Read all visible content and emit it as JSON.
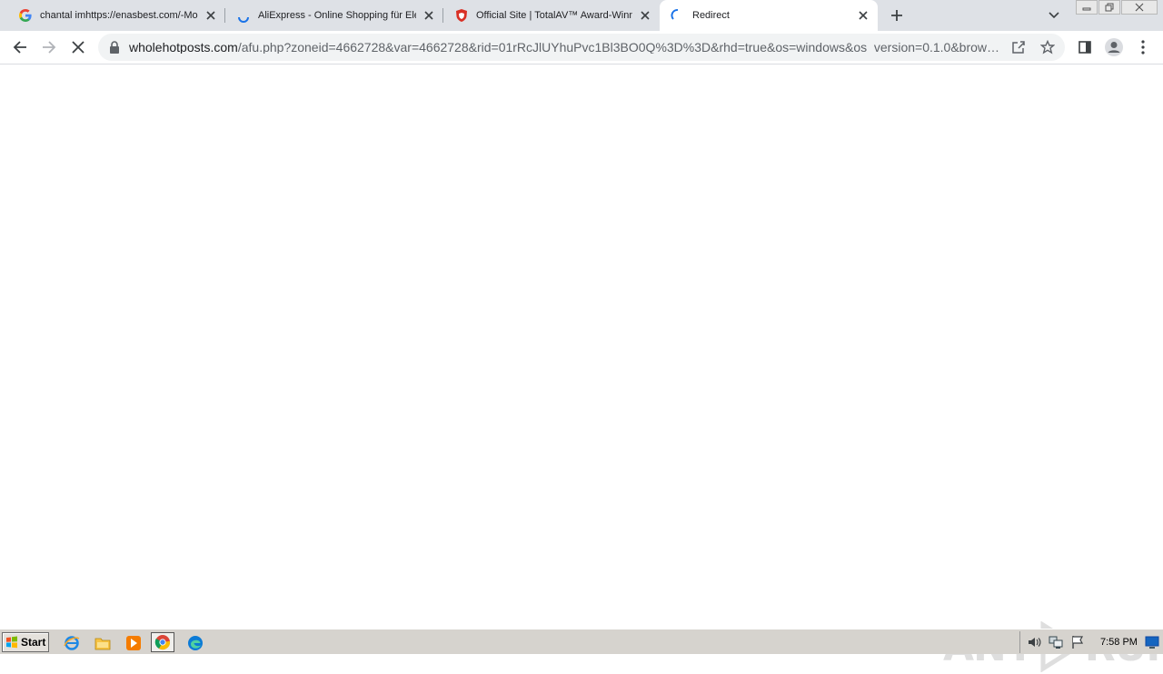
{
  "browser": {
    "tabs": [
      {
        "title": "chantal imhttps://enasbest.com/-Mo",
        "favicon": "google-icon",
        "active": false
      },
      {
        "title": "AliExpress - Online Shopping für Elek",
        "favicon": "loading-icon",
        "active": false
      },
      {
        "title": "Official Site | TotalAV™ Award-Winni",
        "favicon": "totalav-shield-icon",
        "active": false
      },
      {
        "title": "Redirect",
        "favicon": "loading-spinner-icon",
        "active": true
      }
    ],
    "address_bar": {
      "host": "wholehotposts.com",
      "path": "/afu.php?zoneid=4662728&var=4662728&rid=01rRcJlUYhuPvc1Bl3BO0Q%3D%3D&rhd=true&os=windows&os_version=0.1.0&brow…"
    }
  },
  "watermark": {
    "text_left": "ANY",
    "text_right": "RUN"
  },
  "taskbar": {
    "start_label": "Start",
    "clock": "7:58 PM"
  },
  "colors": {
    "tab_strip": "#dee1e6",
    "omnibox": "#f1f3f4",
    "taskbar": "#d6d3ce",
    "totalav_red": "#d93025",
    "spinner_blue": "#1a73e8"
  }
}
